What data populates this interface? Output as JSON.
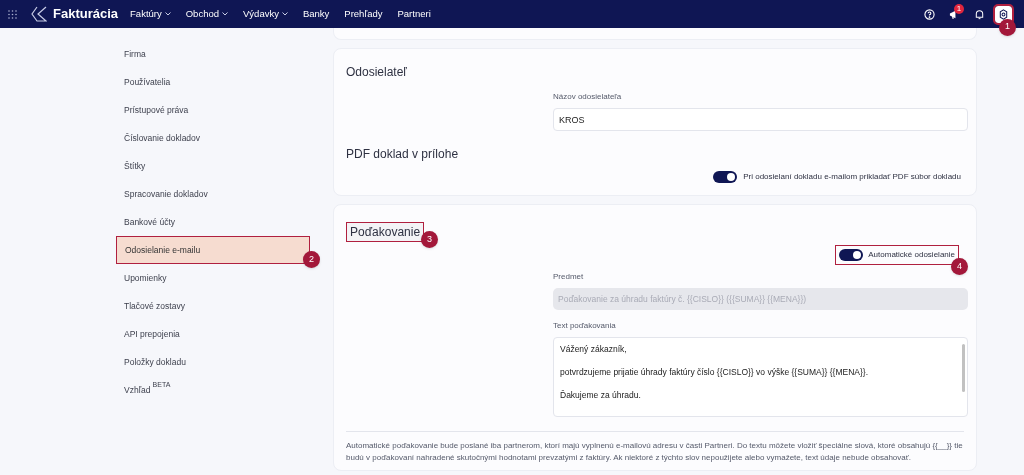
{
  "navbar": {
    "brand": "Fakturácia",
    "menu": [
      {
        "label": "Faktúry",
        "dropdown": true
      },
      {
        "label": "Obchod",
        "dropdown": true
      },
      {
        "label": "Výdavky",
        "dropdown": true
      },
      {
        "label": "Banky",
        "dropdown": false
      },
      {
        "label": "Prehľady",
        "dropdown": false
      },
      {
        "label": "Partneri",
        "dropdown": false
      }
    ],
    "notification_badge": "1",
    "settings_callout": "1"
  },
  "sidebar": {
    "items": [
      {
        "label": "Firma",
        "selected": false
      },
      {
        "label": "Používatelia",
        "selected": false
      },
      {
        "label": "Prístupové práva",
        "selected": false
      },
      {
        "label": "Číslovanie dokladov",
        "selected": false
      },
      {
        "label": "Štítky",
        "selected": false
      },
      {
        "label": "Spracovanie dokladov",
        "selected": false
      },
      {
        "label": "Bankové účty",
        "selected": false
      },
      {
        "label": "Odosielanie e-mailu",
        "selected": true,
        "callout": "2"
      },
      {
        "label": "Upomienky",
        "selected": false
      },
      {
        "label": "Tlačové zostavy",
        "selected": false
      },
      {
        "label": "API prepojenia",
        "selected": false
      },
      {
        "label": "Položky dokladu",
        "selected": false
      },
      {
        "label": "Vzhľad",
        "badge": "BETA",
        "selected": false
      }
    ]
  },
  "sender": {
    "title": "Odosielateľ",
    "name_label": "Názov odosielateľa",
    "name_value": "KROS",
    "pdf_title": "PDF doklad v prílohe",
    "pdf_toggle": {
      "label": "Pri odosielaní dokladu e-mailom prikladať PDF súbor dokladu",
      "on": true
    }
  },
  "thanks": {
    "title": "Poďakovanie",
    "title_callout": "3",
    "auto_toggle": {
      "label": "Automatické odosielanie",
      "on": true,
      "callout": "4"
    },
    "subject_label": "Predmet",
    "subject_placeholder": "Poďakovanie za úhradu faktúry č. {{CISLO}} ({{SUMA}} {{MENA}})",
    "text_label": "Text poďakovania",
    "text_lines": [
      "Vážený zákazník,",
      "potvrdzujeme prijatie úhrady faktúry číslo {{CISLO}} vo výške {{SUMA}} {{MENA}}.",
      "Ďakujeme za úhradu."
    ],
    "note": "Automatické poďakovanie bude poslané iba partnerom, ktorí majú vyplnenú e-mailovú adresu v časti Partneri. Do textu môžete vložiť špeciálne slová, ktoré obsahujú {{__}} tie budú v poďakovaní nahradené skutočnými hodnotami prevzatými z faktúry. Ak niektoré z týchto slov nepoužijete alebo vymažete, text údaje nebude obsahovať."
  }
}
